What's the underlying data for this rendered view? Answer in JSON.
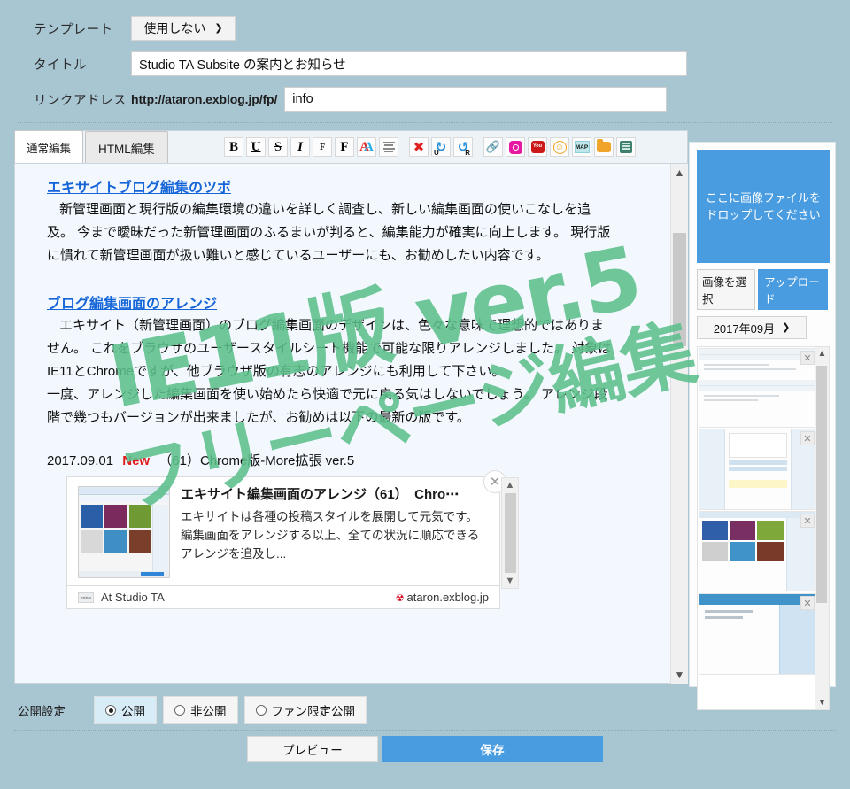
{
  "form": {
    "template_label": "テンプレート",
    "template_value": "使用しない",
    "title_label": "タイトル",
    "title_value": "Studio TA Subsite の案内とお知らせ",
    "link_label": "リンクアドレス",
    "url_prefix": "http://ataron.exblog.jp/fp/",
    "slug_value": "info"
  },
  "editor": {
    "tabs": [
      {
        "label": "通常編集",
        "active": true
      },
      {
        "label": "HTML編集",
        "active": false
      }
    ],
    "toolbar": [
      {
        "name": "bold-icon",
        "glyph": "B"
      },
      {
        "name": "underline-icon",
        "glyph": "U"
      },
      {
        "name": "strikethrough-icon",
        "glyph": "S"
      },
      {
        "name": "italic-icon",
        "glyph": "I"
      },
      {
        "name": "font-size-small-icon",
        "glyph": "F"
      },
      {
        "name": "font-size-large-icon",
        "glyph": "F"
      },
      {
        "name": "text-color-icon",
        "glyph": "A"
      },
      {
        "name": "align-icon",
        "glyph": "≡"
      },
      {
        "name": "clear-format-icon",
        "glyph": "✖"
      },
      {
        "name": "undo-icon",
        "glyph": "U"
      },
      {
        "name": "redo-icon",
        "glyph": "R"
      },
      {
        "name": "link-icon",
        "glyph": "🔗"
      },
      {
        "name": "instagram-icon",
        "glyph": "◉"
      },
      {
        "name": "youtube-icon",
        "glyph": "You Tube"
      },
      {
        "name": "emoji-icon",
        "glyph": "☺"
      },
      {
        "name": "map-icon",
        "glyph": "MAP"
      },
      {
        "name": "folder-icon",
        "glyph": "📁"
      },
      {
        "name": "book-icon",
        "glyph": "📗"
      }
    ],
    "content": {
      "heading1": "エキサイトブログ編集のツボ",
      "para1": "新管理画面と現行版の編集環境の違いを詳しく調査し、新しい編集画面の使いこなしを追及。 今まで曖昧だった新管理画面のふるまいが判ると、編集能力が確実に向上します。 現行版に慣れて新管理画面が扱い難いと感じているユーザーにも、お勧めしたい内容です。",
      "heading2": "ブログ編集画面のアレンジ",
      "para2": "エキサイト（新管理画面）のブログ編集画面のデザインは、色々な意味で理想的ではありません。 これをブラウザのユーザースタイルシート機能で可能な限りアレンジしました。 対象はIE11とChromeですが、他ブラウザ版の有志のアレンジにも利用して下さい。",
      "para3": "一度、アレンジした編集画面を使い始めたら快適で元に戻る気はしないでしょう。 アレンジ段階で幾つもバージョンが出来ましたが、お勧めは以下の最新の版です。",
      "version_date": "2017.09.01",
      "version_new": "New",
      "version_text": "（61）Chrome版-More拡張 ver.5"
    },
    "embed": {
      "title": "エキサイト編集画面のアレンジ（61）　Chro⋯",
      "desc": "エキサイトは各種の投稿スタイルを展開して元気です。 編集画面をアレンジする以上、全ての状況に順応できるアレンジを追及し...",
      "site_name": "At Studio TA",
      "domain": "ataron.exblog.jp",
      "close_glyph": "✕"
    }
  },
  "sidebar": {
    "dropzone_text": "ここに画像ファイルを\nドロップしてください",
    "select_button": "画像を選択",
    "upload_button": "アップロード",
    "month_value": "2017年09月",
    "thumb_delete_glyph": "✕",
    "thumbnails": [
      {
        "name": "thumbnail-1"
      },
      {
        "name": "thumbnail-2"
      },
      {
        "name": "thumbnail-3"
      },
      {
        "name": "thumbnail-4"
      }
    ]
  },
  "publish": {
    "label": "公開設定",
    "options": [
      {
        "label": "公開",
        "selected": true
      },
      {
        "label": "非公開",
        "selected": false
      },
      {
        "label": "ファン限定公開",
        "selected": false
      }
    ]
  },
  "actions": {
    "preview": "プレビュー",
    "save": "保存"
  },
  "watermark": {
    "line1": "IE11版 ver.5",
    "line2": "フリーページ編集",
    "color": "#5cc08c"
  },
  "colors": {
    "page_background": "#a8c5d2",
    "accent_blue": "#4a9ce0",
    "editor_background": "#f2f8fd",
    "link_blue": "#1565d8",
    "new_red": "#e01b1b"
  }
}
